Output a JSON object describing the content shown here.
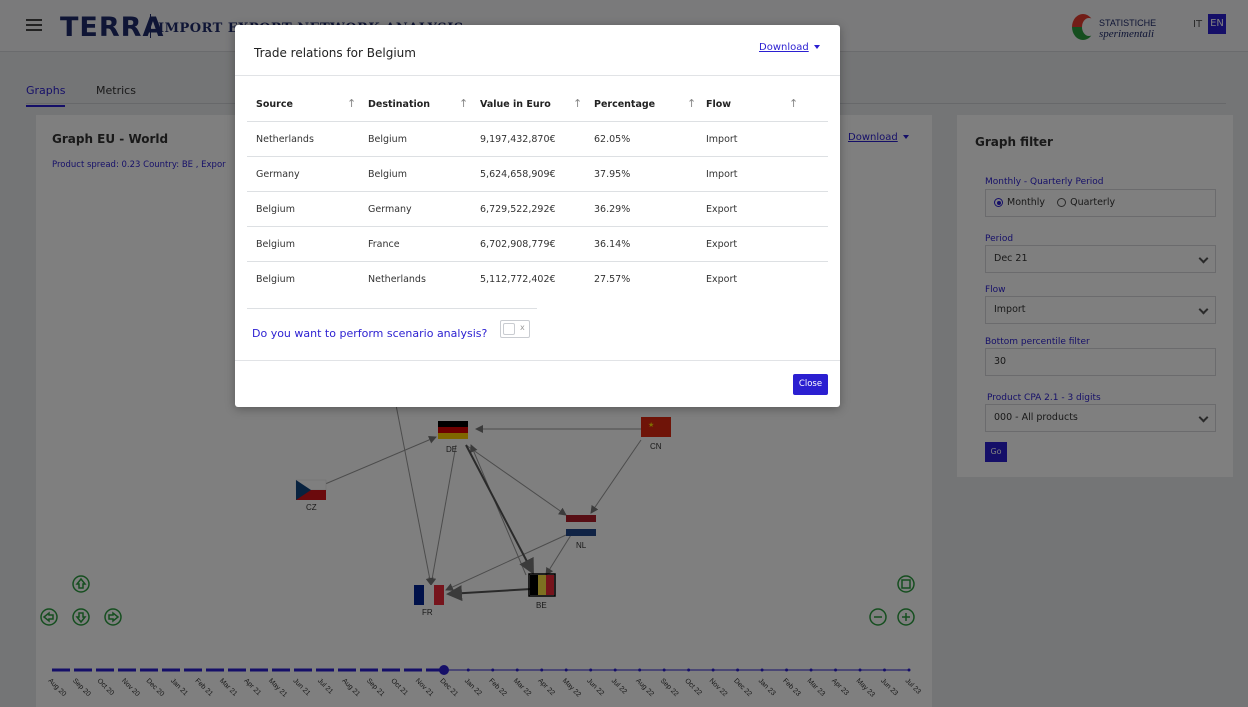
{
  "header": {
    "logo": "TERRA",
    "subtitle": "IMPORT EXPORT NETWORK ANALYSIS",
    "partner_line1": "STATISTICHE",
    "partner_line2": "sperimentali",
    "lang_it": "IT",
    "lang_en": "EN"
  },
  "tabs": [
    {
      "label": "Graphs",
      "active": true
    },
    {
      "label": "Metrics",
      "active": false
    }
  ],
  "graph": {
    "title": "Graph EU - World",
    "subtitle": "Product spread: 0.23  Country: BE , Expor",
    "download_label": "Download",
    "nodes": [
      {
        "code": "DE",
        "label": "DE"
      },
      {
        "code": "CN",
        "label": "CN"
      },
      {
        "code": "CZ",
        "label": "CZ"
      },
      {
        "code": "NL",
        "label": "NL"
      },
      {
        "code": "FR",
        "label": "FR"
      },
      {
        "code": "BE",
        "label": "BE"
      }
    ],
    "timeline": [
      "Aug 20",
      "Sep 20",
      "Oct 20",
      "Nov 20",
      "Dec 20",
      "Jan 21",
      "Feb 21",
      "Mar 21",
      "Apr 21",
      "May 21",
      "Jun 21",
      "Jul 21",
      "Aug 21",
      "Sep 21",
      "Oct 21",
      "Nov 21",
      "Dec 21",
      "Jan 22",
      "Feb 22",
      "Mar 22",
      "Apr 22",
      "May 22",
      "Jun 22",
      "Jul 22",
      "Aug 22",
      "Sep 22",
      "Oct 22",
      "Nov 22",
      "Dec 22",
      "Jan 23",
      "Feb 23",
      "Mar 23",
      "Apr 23",
      "May 23",
      "Jun 23",
      "Jul 23"
    ],
    "timeline_selected": "Dec 21"
  },
  "filter": {
    "title": "Graph filter",
    "period_type_label": "Monthly - Quarterly Period",
    "period_type_options": [
      "Monthly",
      "Quarterly"
    ],
    "period_type_selected": "Monthly",
    "period_label": "Period",
    "period_value": "Dec 21",
    "flow_label": "Flow",
    "flow_value": "Import",
    "percentile_label": "Bottom percentile filter",
    "percentile_value": "30",
    "product_label": "Product CPA 2.1 - 3 digits",
    "product_value": "000 - All products",
    "go_label": "Go"
  },
  "modal": {
    "title": "Trade relations for Belgium",
    "download_label": "Download",
    "columns": [
      "Source",
      "Destination",
      "Value in Euro",
      "Percentage",
      "Flow"
    ],
    "rows": [
      [
        "Netherlands",
        "Belgium",
        "9,197,432,870€",
        "62.05%",
        "Import"
      ],
      [
        "Germany",
        "Belgium",
        "5,624,658,909€",
        "37.95%",
        "Import"
      ],
      [
        "Belgium",
        "Germany",
        "6,729,522,292€",
        "36.29%",
        "Export"
      ],
      [
        "Belgium",
        "France",
        "6,702,908,779€",
        "36.14%",
        "Export"
      ],
      [
        "Belgium",
        "Netherlands",
        "5,112,772,402€",
        "27.57%",
        "Export"
      ]
    ],
    "scenario_question": "Do you want to perform scenario analysis?",
    "toggle_x": "x",
    "close_label": "Close"
  }
}
